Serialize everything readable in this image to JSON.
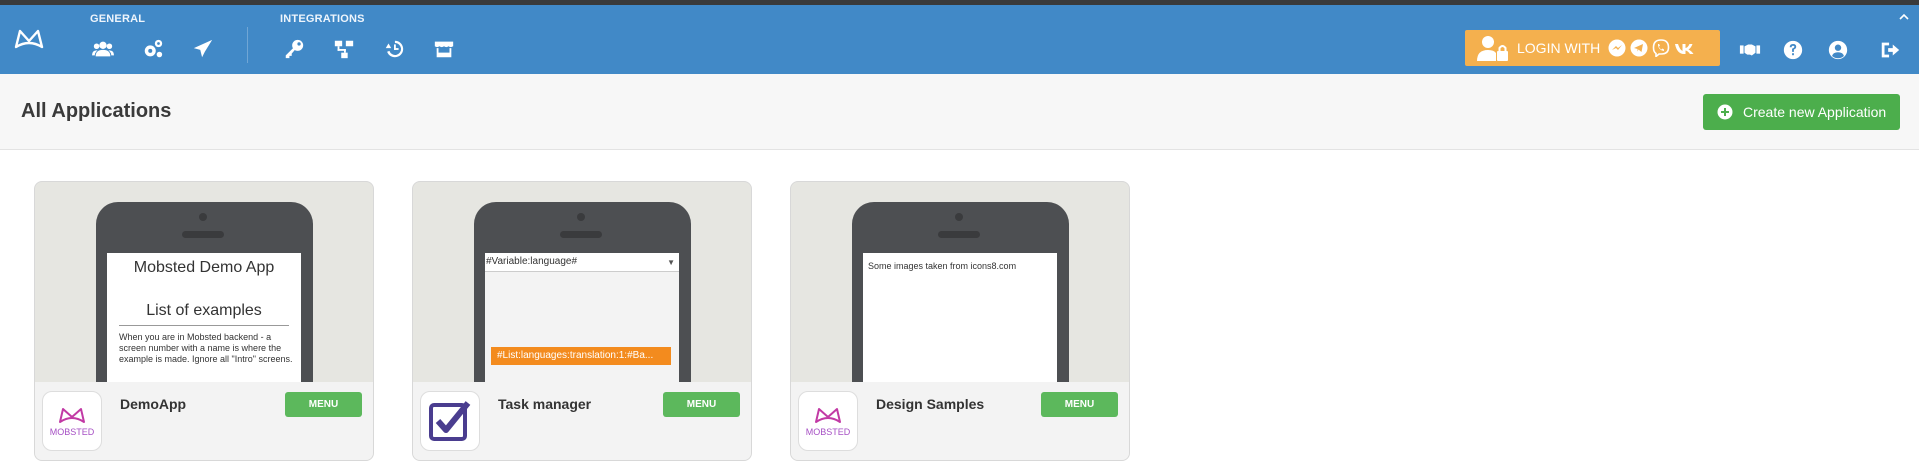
{
  "nav": {
    "general_label": "GENERAL",
    "integrations_label": "INTEGRATIONS",
    "general_icons": [
      "users-icon",
      "cogs-icon",
      "send-icon"
    ],
    "integration_icons": [
      "key-icon",
      "sitemap-icon",
      "history-icon",
      "store-icon"
    ],
    "login_label": "LOGIN WITH",
    "social_icons": [
      "messenger-icon",
      "telegram-icon",
      "viber-icon",
      "vk-icon"
    ],
    "right_icons": [
      "handshake-icon",
      "help-icon",
      "account-icon",
      "logout-icon"
    ],
    "colors": {
      "bar": "#4189c7",
      "login": "#f4b04e"
    }
  },
  "header": {
    "title": "All Applications",
    "create_label": "Create new Application",
    "create_color": "#4cae4c"
  },
  "apps": [
    {
      "name": "DemoApp",
      "menu_label": "MENU",
      "icon": "mobsted-logo-icon",
      "icon_text": "MOBSTED",
      "screen": {
        "title": "Mobsted Demo App",
        "subtitle": "List of examples",
        "body": "When you are in Mobsted backend - a screen number with a name is where the example is made. Ignore all \"Intro\" screens."
      }
    },
    {
      "name": "Task manager",
      "menu_label": "MENU",
      "icon": "checkbox-icon",
      "screen": {
        "select_value": "#Variable:language#",
        "button_text": "#List:languages:translation:1:#Ba..."
      }
    },
    {
      "name": "Design Samples",
      "menu_label": "MENU",
      "icon": "mobsted-logo-icon",
      "icon_text": "MOBSTED",
      "screen": {
        "text": "Some images taken from icons8.com"
      }
    }
  ]
}
